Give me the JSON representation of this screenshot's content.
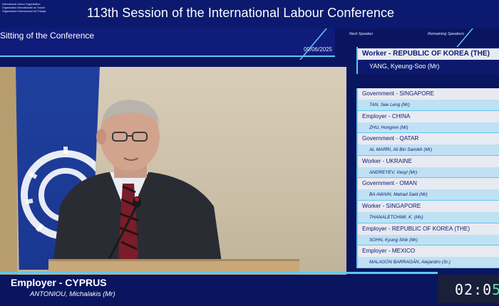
{
  "header": {
    "logo_lines": [
      "International Labour Organization",
      "Organisation internationale du Travail",
      "Organización Internacional del Trabajo"
    ],
    "title": "113th Session of the International Labour Conference"
  },
  "subheader": {
    "sitting": "Sitting of the Conference",
    "date": "09/06/2025"
  },
  "panel": {
    "next_label": "Next Speaker",
    "remaining_label": "Remaining Speakers"
  },
  "next_speaker": {
    "role": "Worker - REPUBLIC OF KOREA (THE)",
    "name": "YANG, Kyeung-Soo (Mr)"
  },
  "remaining_speakers": [
    {
      "role": "Government - SINGAPORE",
      "name": "TAN, See Leng (Mr)"
    },
    {
      "role": "Employer - CHINA",
      "name": "ZHU, Hongren (Mr)"
    },
    {
      "role": "Government - QATAR",
      "name": "AL MARRI, Ali Bin Samikh (Mr)"
    },
    {
      "role": "Worker - UKRAINE",
      "name": "ANDREYEV, Vasyl (Mr)"
    },
    {
      "role": "Government - OMAN",
      "name": "BA AWAIN, Mahad Said (Mr)"
    },
    {
      "role": "Worker - SINGAPORE",
      "name": "THANALETCHIMI, K. (Ms)"
    },
    {
      "role": "Employer - REPUBLIC OF KOREA (THE)",
      "name": "SOHN, Kyung Shik (Mr)"
    },
    {
      "role": "Employer - MEXICO",
      "name": "MALAGÓN BARRAGÁN, Alejandro (Sr.)"
    }
  ],
  "current_speaker": {
    "role": "Employer - CYPRUS",
    "name": "ANTONIOU, Michalakis (Mr)"
  },
  "timer": {
    "main": "02:0",
    "accent": "5"
  },
  "colors": {
    "background": "#0a1560",
    "accent": "#5ec8f0",
    "timer_accent": "#58e0a0"
  }
}
